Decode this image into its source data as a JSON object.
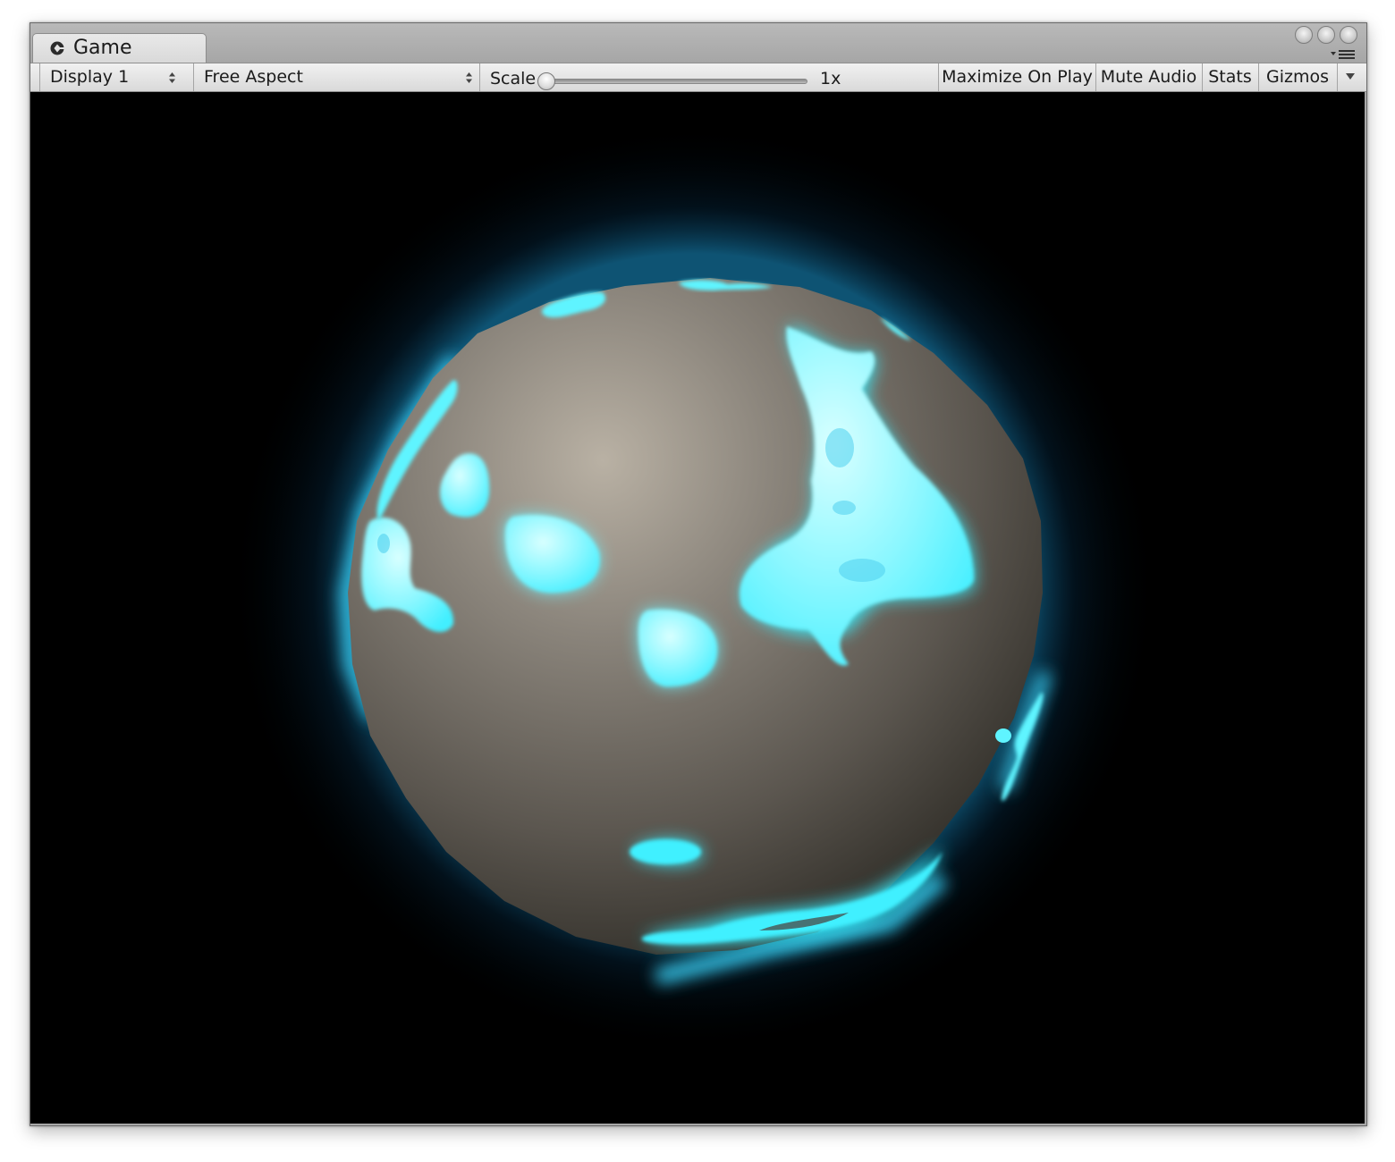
{
  "window": {
    "tab_title": "Game",
    "tab_icon": "unity-logo-icon"
  },
  "toolbar": {
    "display": "Display 1",
    "aspect": "Free Aspect",
    "scale_label": "Scale",
    "scale_value": "1x",
    "scale_slider_fraction": 0.0,
    "maximize_on_play": "Maximize On Play",
    "mute_audio": "Mute Audio",
    "stats": "Stats",
    "gizmos": "Gizmos"
  },
  "colors": {
    "sphere": "#8a857c",
    "glow": "#38f2ff",
    "background": "#000000",
    "chrome": "#a8a8a8"
  }
}
